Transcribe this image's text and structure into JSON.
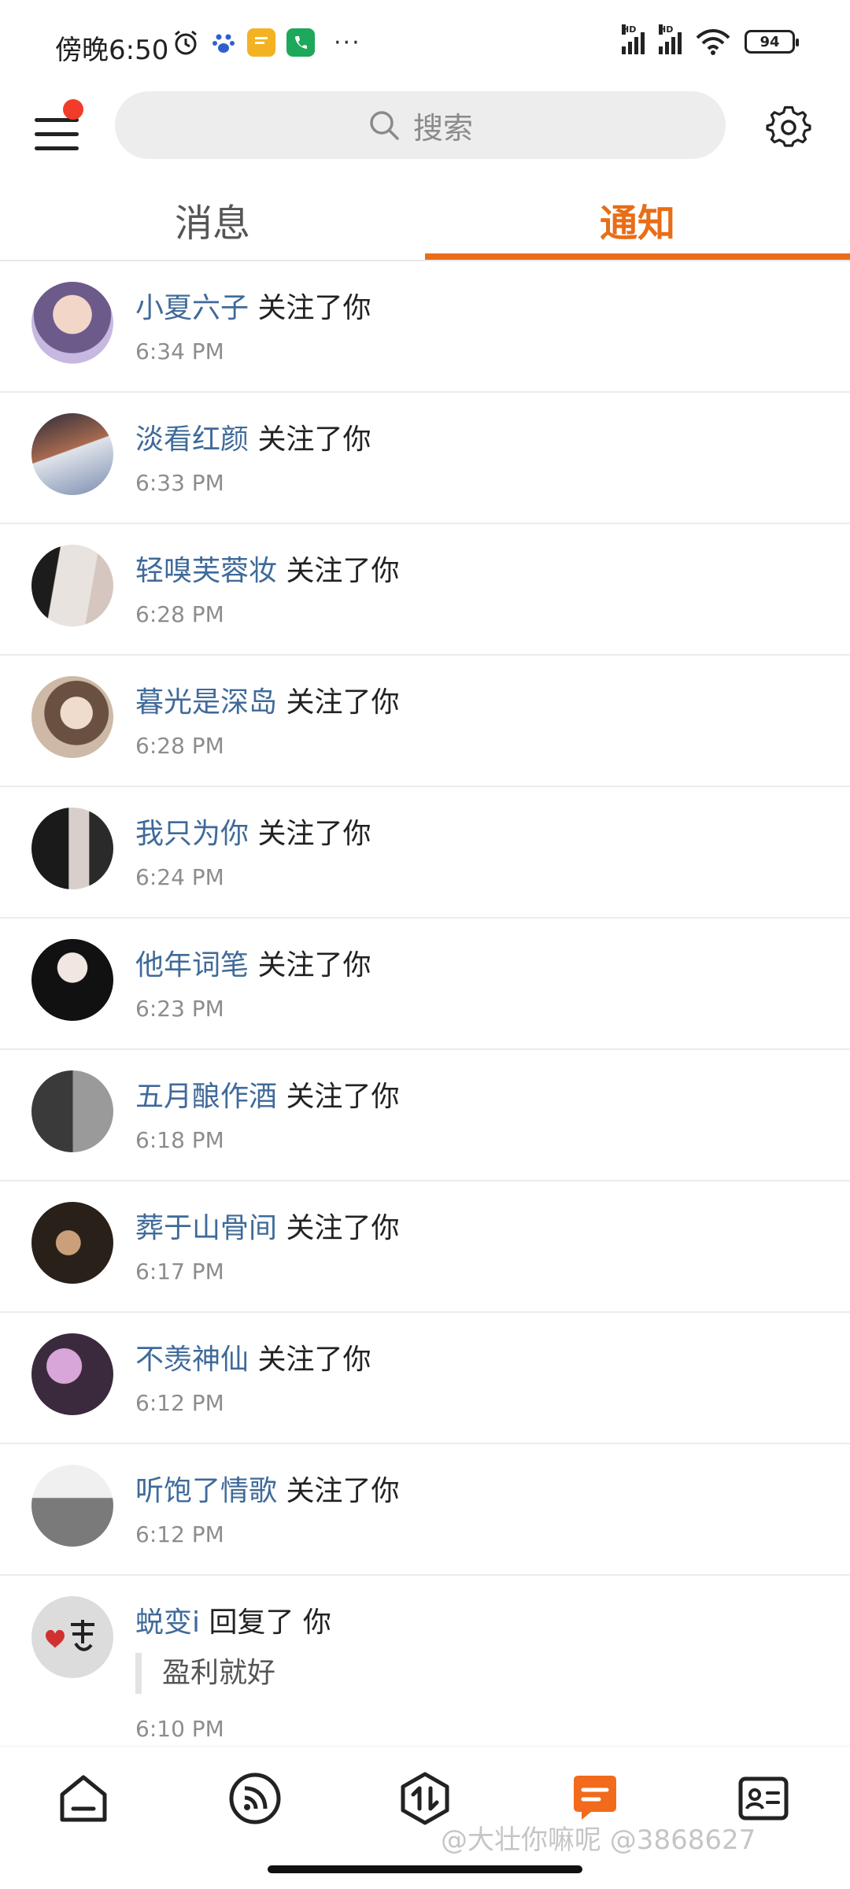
{
  "status_bar": {
    "time": "傍晚6:50",
    "battery": "94",
    "signal_label": "HD"
  },
  "header": {
    "search_placeholder": "搜索"
  },
  "tabs": [
    {
      "label": "消息"
    },
    {
      "label": "通知"
    }
  ],
  "notifications": [
    {
      "name": "小夏六子",
      "action": " 关注了你",
      "time": "6:34 PM"
    },
    {
      "name": "淡看红颜",
      "action": " 关注了你",
      "time": "6:33 PM"
    },
    {
      "name": "轻嗅芙蓉妆",
      "action": " 关注了你",
      "time": "6:28 PM"
    },
    {
      "name": "暮光是深岛",
      "action": " 关注了你",
      "time": "6:28 PM"
    },
    {
      "name": "我只为你",
      "action": " 关注了你",
      "time": "6:24 PM"
    },
    {
      "name": "他年词笔",
      "action": " 关注了你",
      "time": "6:23 PM"
    },
    {
      "name": "五月酿作酒",
      "action": " 关注了你",
      "time": "6:18 PM"
    },
    {
      "name": "葬于山骨间",
      "action": " 关注了你",
      "time": "6:17 PM"
    },
    {
      "name": "不羡神仙",
      "action": " 关注了你",
      "time": "6:12 PM"
    },
    {
      "name": "听饱了情歌",
      "action": " 关注了你",
      "time": "6:12 PM"
    },
    {
      "name": "蜕变i",
      "action": " 回复了 你",
      "quote": "盈利就好",
      "time": "6:10 PM"
    }
  ],
  "watermark": "@大壮你嘛呢 @3868627"
}
